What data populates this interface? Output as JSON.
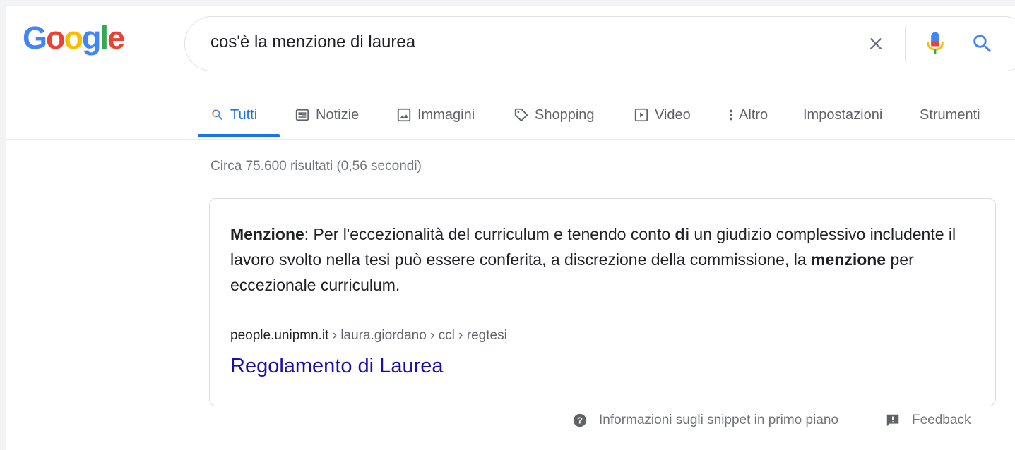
{
  "logo": {
    "letters": [
      {
        "char": "G",
        "color": "#4285f4"
      },
      {
        "char": "o",
        "color": "#ea4335"
      },
      {
        "char": "o",
        "color": "#fbbc05"
      },
      {
        "char": "g",
        "color": "#4285f4"
      },
      {
        "char": "l",
        "color": "#34a853"
      },
      {
        "char": "e",
        "color": "#ea4335"
      }
    ]
  },
  "search": {
    "query": "cos'è la menzione di laurea",
    "icons": [
      "close-icon",
      "microphone-icon",
      "search-icon"
    ]
  },
  "tabs": [
    {
      "label": "Tutti",
      "icon": "search-icon",
      "active": true
    },
    {
      "label": "Notizie",
      "icon": "news-icon"
    },
    {
      "label": "Immagini",
      "icon": "image-icon"
    },
    {
      "label": "Shopping",
      "icon": "tag-icon"
    },
    {
      "label": "Video",
      "icon": "play-icon"
    },
    {
      "label": "Altro",
      "icon": "more-vert-icon"
    },
    {
      "label": "Impostazioni"
    },
    {
      "label": "Strumenti"
    }
  ],
  "result_stats": "Circa 75.600 risultati (0,56 secondi)",
  "featured_snippet": {
    "text_parts": [
      {
        "text": "Menzione",
        "bold": true
      },
      {
        "text": ": Per l'eccezionalità del curriculum e tenendo conto ",
        "bold": false
      },
      {
        "text": "di",
        "bold": true
      },
      {
        "text": " un giudizio complessivo includente il lavoro svolto nella tesi può essere conferita, a discrezione della commissione, la ",
        "bold": false
      },
      {
        "text": "menzione",
        "bold": true
      },
      {
        "text": " per eccezionale curriculum.",
        "bold": false
      }
    ],
    "domain": "people.unipmn.it",
    "path": " › laura.giordano › ccl › regtesi",
    "title": "Regolamento di Laurea"
  },
  "footer": {
    "about_label": "Informazioni sugli snippet in primo piano",
    "feedback_label": "Feedback"
  },
  "colors": {
    "accent": "#1a73e8",
    "link": "#1a0dab",
    "muted": "#70757a"
  }
}
